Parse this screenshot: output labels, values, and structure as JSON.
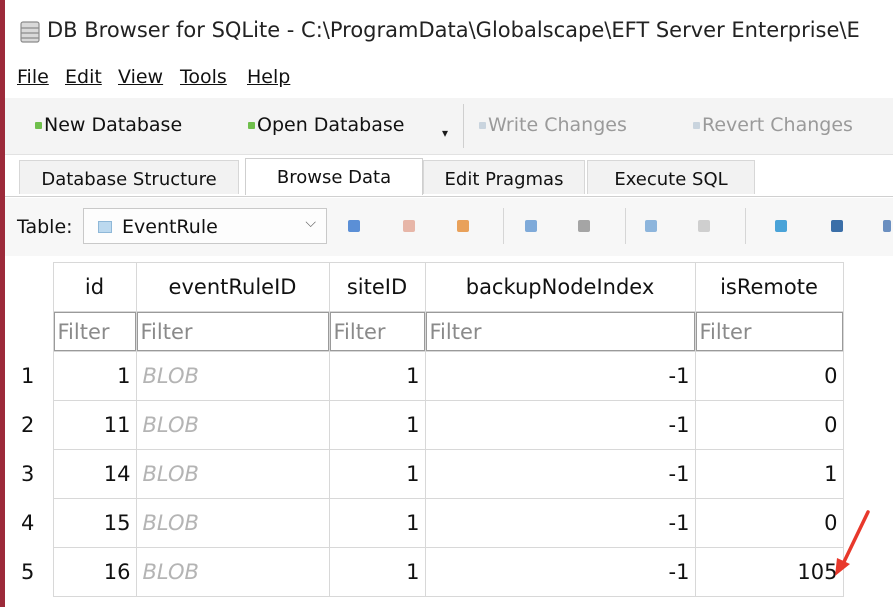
{
  "window": {
    "title": "DB Browser for SQLite - C:\\ProgramData\\Globalscape\\EFT Server Enterprise\\E"
  },
  "menu": [
    "File",
    "Edit",
    "View",
    "Tools",
    "Help"
  ],
  "toolbar": {
    "new_db": "New Database",
    "open_db": "Open Database",
    "write": "Write Changes",
    "revert": "Revert Changes"
  },
  "tabs": [
    "Database Structure",
    "Browse Data",
    "Edit Pragmas",
    "Execute SQL"
  ],
  "active_tab": "Browse Data",
  "browse": {
    "table_label": "Table:",
    "table_name": "EventRule"
  },
  "grid": {
    "columns": [
      "id",
      "eventRuleID",
      "siteID",
      "backupNodeIndex",
      "isRemote"
    ],
    "filter_placeholder": "Filter",
    "rows": [
      {
        "rownum": "1",
        "id": "1",
        "eventRuleID": "BLOB",
        "siteID": "1",
        "backupNodeIndex": "-1",
        "isRemote": "0"
      },
      {
        "rownum": "2",
        "id": "11",
        "eventRuleID": "BLOB",
        "siteID": "1",
        "backupNodeIndex": "-1",
        "isRemote": "0"
      },
      {
        "rownum": "3",
        "id": "14",
        "eventRuleID": "BLOB",
        "siteID": "1",
        "backupNodeIndex": "-1",
        "isRemote": "1"
      },
      {
        "rownum": "4",
        "id": "15",
        "eventRuleID": "BLOB",
        "siteID": "1",
        "backupNodeIndex": "-1",
        "isRemote": "0"
      },
      {
        "rownum": "5",
        "id": "16",
        "eventRuleID": "BLOB",
        "siteID": "1",
        "backupNodeIndex": "-1",
        "isRemote": "105"
      }
    ]
  },
  "colors": {
    "annotation_arrow": "#e8382b",
    "left_border": "#9c2a3a"
  }
}
